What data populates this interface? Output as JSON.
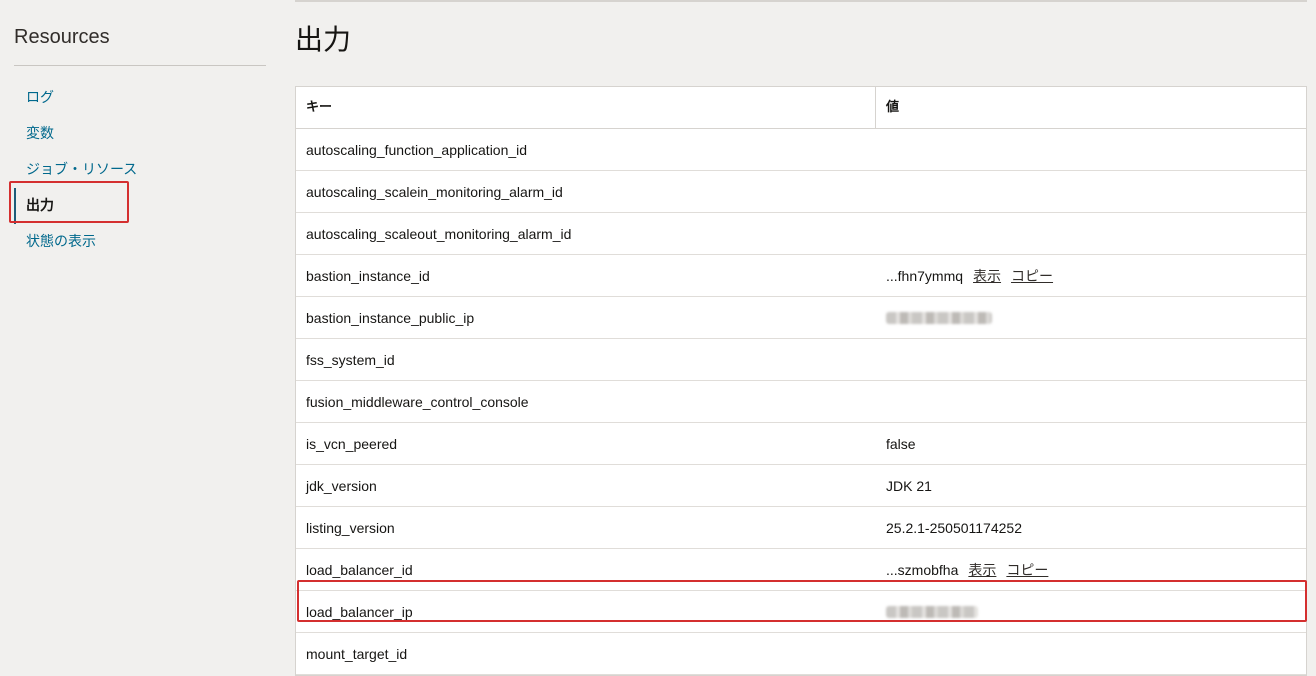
{
  "sidebar": {
    "title": "Resources",
    "items": [
      {
        "label": "ログ"
      },
      {
        "label": "変数"
      },
      {
        "label": "ジョブ・リソース"
      },
      {
        "label": "出力"
      },
      {
        "label": "状態の表示"
      }
    ]
  },
  "main": {
    "title": "出力",
    "table": {
      "headers": {
        "key": "キー",
        "value": "値"
      },
      "rows": [
        {
          "key": "autoscaling_function_application_id",
          "value": ""
        },
        {
          "key": "autoscaling_scalein_monitoring_alarm_id",
          "value": ""
        },
        {
          "key": "autoscaling_scaleout_monitoring_alarm_id",
          "value": ""
        },
        {
          "key": "bastion_instance_id",
          "value": "...fhn7ymmq",
          "show": "表示",
          "copy": "コピー"
        },
        {
          "key": "bastion_instance_public_ip",
          "value": ""
        },
        {
          "key": "fss_system_id",
          "value": ""
        },
        {
          "key": "fusion_middleware_control_console",
          "value": ""
        },
        {
          "key": "is_vcn_peered",
          "value": "false"
        },
        {
          "key": "jdk_version",
          "value": "JDK 21"
        },
        {
          "key": "listing_version",
          "value": "25.2.1-250501174252"
        },
        {
          "key": "load_balancer_id",
          "value": "...szmobfha",
          "show": "表示",
          "copy": "コピー"
        },
        {
          "key": "load_balancer_ip",
          "value": ""
        },
        {
          "key": "mount_target_id",
          "value": ""
        }
      ]
    }
  },
  "colors": {
    "link": "#00688c",
    "highlight": "#d42f2f",
    "background": "#f1f0ee"
  }
}
